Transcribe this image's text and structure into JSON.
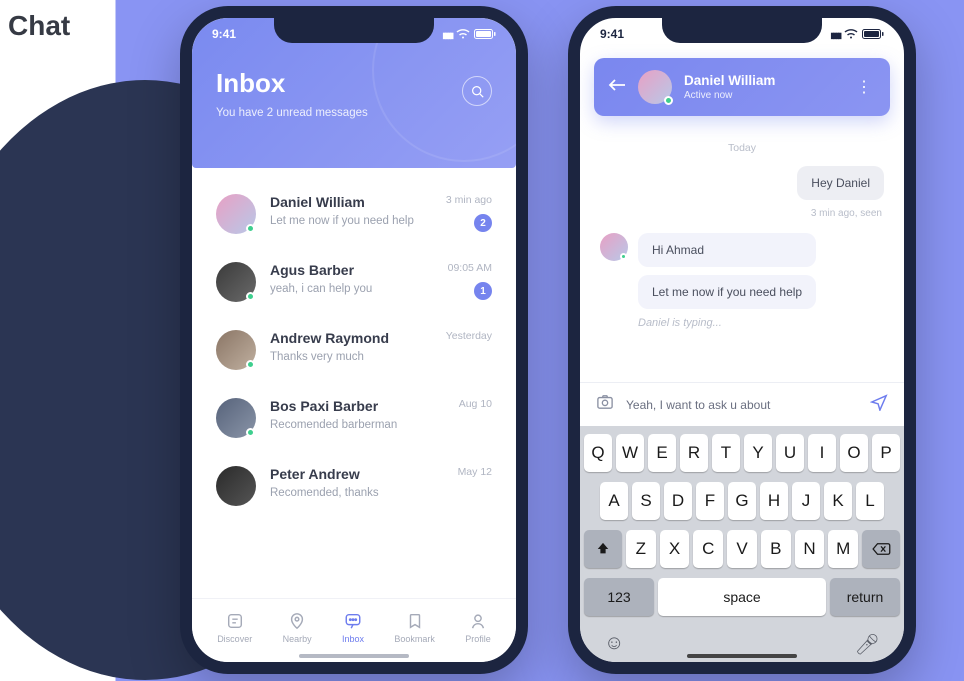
{
  "page_title": "Chat",
  "status": {
    "time": "9:41"
  },
  "inbox": {
    "title": "Inbox",
    "subtitle": "You have 2 unread messages",
    "items": [
      {
        "name": "Daniel William",
        "preview": "Let me now if you need help",
        "time": "3 min ago",
        "badge": "2"
      },
      {
        "name": "Agus Barber",
        "preview": "yeah, i can help you",
        "time": "09:05 AM",
        "badge": "1"
      },
      {
        "name": "Andrew Raymond",
        "preview": "Thanks very much",
        "time": "Yesterday",
        "badge": ""
      },
      {
        "name": "Bos Paxi Barber",
        "preview": "Recomended barberman",
        "time": "Aug 10",
        "badge": ""
      },
      {
        "name": "Peter Andrew",
        "preview": "Recomended, thanks",
        "time": "May 12",
        "badge": ""
      }
    ]
  },
  "tabs": {
    "discover": "Discover",
    "nearby": "Nearby",
    "inbox": "Inbox",
    "bookmark": "Bookmark",
    "profile": "Profile"
  },
  "conversation": {
    "name": "Daniel William",
    "status": "Active now",
    "day": "Today",
    "out_msg": "Hey Daniel",
    "out_meta": "3 min ago, seen",
    "in_msg1": "Hi Ahmad",
    "in_msg2": "Let me now if you need help",
    "typing": "Daniel is typing...",
    "compose_value": "Yeah, I want to ask u about"
  },
  "keyboard": {
    "row1": [
      "Q",
      "W",
      "E",
      "R",
      "T",
      "Y",
      "U",
      "I",
      "O",
      "P"
    ],
    "row2": [
      "A",
      "S",
      "D",
      "F",
      "G",
      "H",
      "J",
      "K",
      "L"
    ],
    "row3": [
      "Z",
      "X",
      "C",
      "V",
      "B",
      "N",
      "M"
    ],
    "num": "123",
    "space": "space",
    "return": "return"
  }
}
